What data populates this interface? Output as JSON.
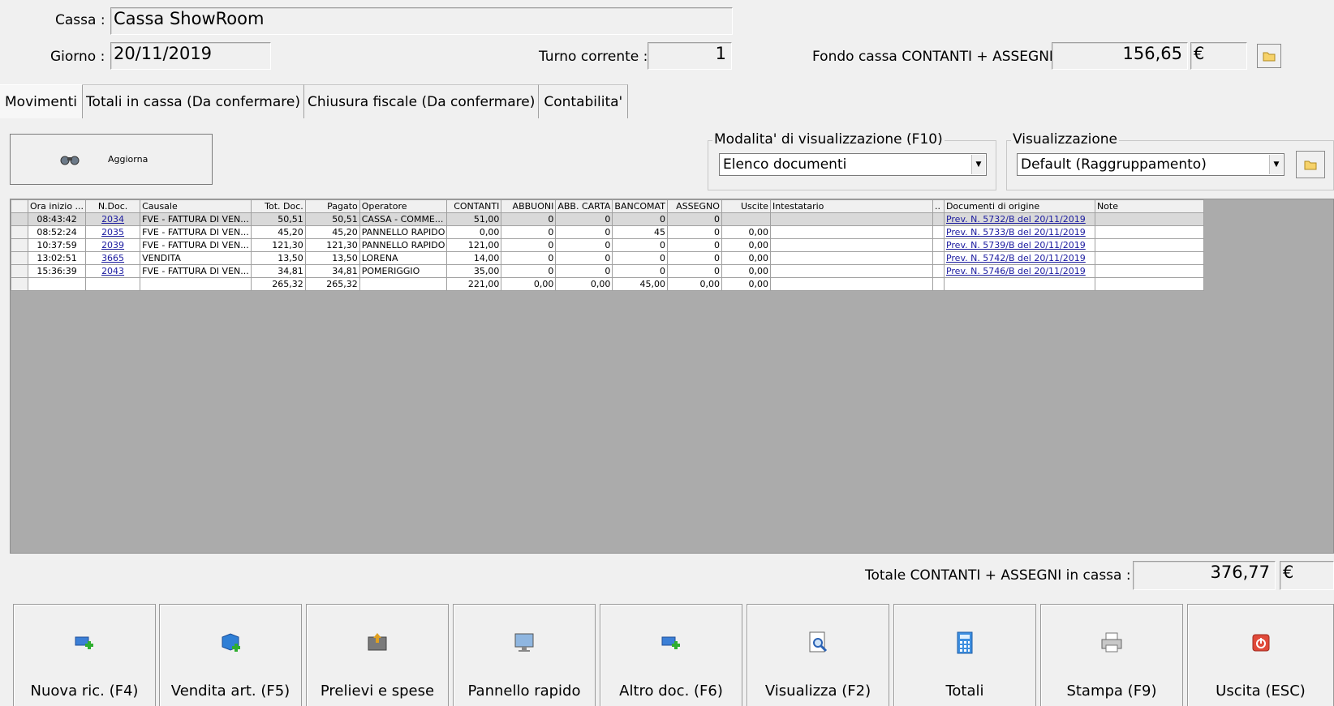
{
  "header": {
    "cassa_label": "Cassa :",
    "cassa_value": "Cassa ShowRoom",
    "giorno_label": "Giorno :",
    "giorno_value": "20/11/2019",
    "turno_label": "Turno corrente :",
    "turno_value": "1",
    "fondo_label": "Fondo cassa CONTANTI + ASSEGNI :",
    "fondo_value": "156,65",
    "currency": "€"
  },
  "tabs": [
    {
      "label": "Movimenti"
    },
    {
      "label": "Totali in cassa (Da confermare)"
    },
    {
      "label": "Chiusura fiscale (Da confermare)"
    },
    {
      "label": "Contabilita'"
    }
  ],
  "toolbar": {
    "aggiorna_label": "Aggiorna"
  },
  "modalita": {
    "title": "Modalita' di visualizzazione (F10)",
    "selected": "Elenco documenti"
  },
  "visualizzazione": {
    "title": "Visualizzazione",
    "selected": "Default (Raggruppamento)"
  },
  "grid": {
    "columns": [
      "Ora inizio ...",
      "N.Doc.",
      "Causale",
      "Tot. Doc.",
      "Pagato",
      "Operatore",
      "CONTANTI",
      "ABBUONI",
      "ABB. CARTA",
      "BANCOMAT",
      "ASSEGNO",
      "Uscite",
      "Intestatario",
      "..",
      "Documenti di origine",
      "Note"
    ],
    "rows": [
      [
        "08:43:42",
        "2034",
        "FVE - FATTURA DI VEN...",
        "50,51",
        "50,51",
        "CASSA - COMME...",
        "51,00",
        "0",
        "0",
        "0",
        "0",
        "",
        "",
        "",
        "Prev. N. 5732/B del 20/11/2019",
        ""
      ],
      [
        "08:52:24",
        "2035",
        "FVE - FATTURA DI VEN...",
        "45,20",
        "45,20",
        "PANNELLO RAPIDO",
        "0,00",
        "0",
        "0",
        "45",
        "0",
        "0,00",
        "",
        "",
        "Prev. N. 5733/B del 20/11/2019",
        ""
      ],
      [
        "10:37:59",
        "2039",
        "FVE - FATTURA DI VEN...",
        "121,30",
        "121,30",
        "PANNELLO RAPIDO",
        "121,00",
        "0",
        "0",
        "0",
        "0",
        "0,00",
        "",
        "",
        "Prev. N. 5739/B del 20/11/2019",
        ""
      ],
      [
        "13:02:51",
        "3665",
        "VENDITA",
        "13,50",
        "13,50",
        "LORENA",
        "14,00",
        "0",
        "0",
        "0",
        "0",
        "0,00",
        "",
        "",
        "Prev. N. 5742/B del 20/11/2019",
        ""
      ],
      [
        "15:36:39",
        "2043",
        "FVE - FATTURA DI VEN...",
        "34,81",
        "34,81",
        "POMERIGGIO",
        "35,00",
        "0",
        "0",
        "0",
        "0",
        "0,00",
        "",
        "",
        "Prev. N. 5746/B del 20/11/2019",
        ""
      ]
    ],
    "totals": [
      "",
      "",
      "",
      "265,32",
      "265,32",
      "",
      "221,00",
      "0,00",
      "0,00",
      "45,00",
      "0,00",
      "0,00",
      "",
      "",
      "",
      ""
    ]
  },
  "totale": {
    "label": "Totale CONTANTI + ASSEGNI in cassa :",
    "value": "376,77",
    "currency": "€"
  },
  "buttons": [
    {
      "label": "Nuova ric. (F4)",
      "icon": "new-receipt-icon"
    },
    {
      "label": "Vendita art. (F5)",
      "icon": "sell-article-icon"
    },
    {
      "label": "Prelievi e spese",
      "icon": "withdraw-icon"
    },
    {
      "label": "Pannello rapido",
      "icon": "monitor-icon"
    },
    {
      "label": "Altro doc. (F6)",
      "icon": "other-doc-icon"
    },
    {
      "label": "Visualizza (F2)",
      "icon": "view-document-icon"
    },
    {
      "label": "Totali",
      "icon": "calculator-icon"
    },
    {
      "label": "Stampa (F9)",
      "icon": "printer-icon"
    },
    {
      "label": "Uscita (ESC)",
      "icon": "power-off-icon"
    }
  ]
}
